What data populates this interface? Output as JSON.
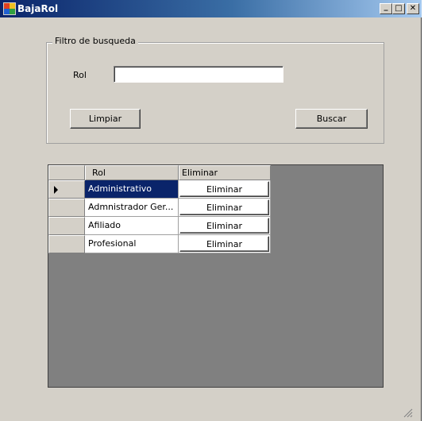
{
  "window": {
    "title": "BajaRol"
  },
  "title_buttons": {
    "minimize": "_",
    "maximize": "□",
    "close": "✕"
  },
  "filter": {
    "legend": "Filtro de busqueda",
    "rol_label": "Rol",
    "rol_value": "",
    "clear_label": "Limpiar",
    "search_label": "Buscar"
  },
  "grid": {
    "columns": [
      "Rol",
      "Eliminar"
    ],
    "rows": [
      {
        "rol": "Administrativo",
        "action": "Eliminar",
        "selected": true
      },
      {
        "rol": "Admnistrador Ger...",
        "action": "Eliminar",
        "selected": false
      },
      {
        "rol": "Afiliado",
        "action": "Eliminar",
        "selected": false
      },
      {
        "rol": "Profesional",
        "action": "Eliminar",
        "selected": false
      }
    ]
  },
  "colors": {
    "titlebar_start": "#0a246a",
    "titlebar_end": "#a6caf0",
    "selection": "#0a246a",
    "grid_background": "#808080"
  }
}
